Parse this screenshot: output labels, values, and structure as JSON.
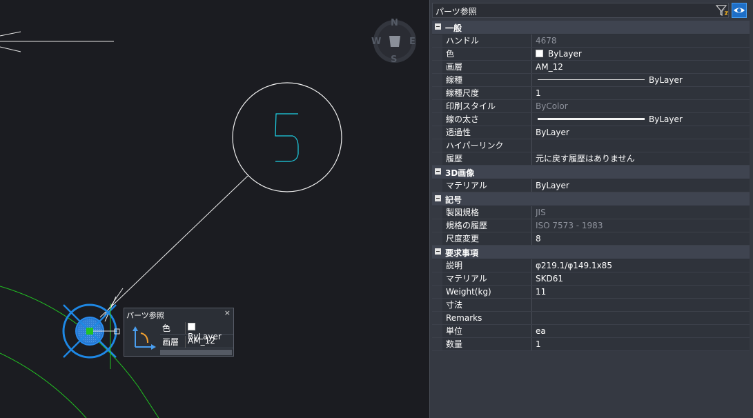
{
  "canvas": {
    "balloon_number": "5",
    "compass": {
      "n": "N",
      "s": "S",
      "e": "E",
      "w": "W"
    }
  },
  "panel": {
    "selector_value": "パーツ参照",
    "categories": [
      {
        "name": "一般",
        "rows": [
          {
            "label": "ハンドル",
            "value": "4678",
            "dim": true
          },
          {
            "label": "色",
            "value": "ByLayer",
            "swatch": true
          },
          {
            "label": "画層",
            "value": "AM_12"
          },
          {
            "label": "線種",
            "value": "ByLayer",
            "line": "thin"
          },
          {
            "label": "線種尺度",
            "value": "1"
          },
          {
            "label": "印刷スタイル",
            "value": "ByColor",
            "dim": true
          },
          {
            "label": "線の太さ",
            "value": "ByLayer",
            "line": "thick"
          },
          {
            "label": "透過性",
            "value": "ByLayer"
          },
          {
            "label": "ハイパーリンク",
            "value": ""
          },
          {
            "label": "履歴",
            "value": "元に戻す履歴はありません"
          }
        ]
      },
      {
        "name": "3D画像",
        "rows": [
          {
            "label": "マテリアル",
            "value": "ByLayer"
          }
        ]
      },
      {
        "name": "記号",
        "rows": [
          {
            "label": "製図規格",
            "value": "JIS",
            "dim": true
          },
          {
            "label": "規格の履歴",
            "value": "ISO 7573 - 1983",
            "dim": true
          },
          {
            "label": "尺度変更",
            "value": "8"
          }
        ]
      },
      {
        "name": "要求事項",
        "rows": [
          {
            "label": "説明",
            "value": "φ219.1/φ149.1x85"
          },
          {
            "label": "マテリアル",
            "value": "SKD61"
          },
          {
            "label": "Weight(kg)",
            "value": "11"
          },
          {
            "label": "寸法",
            "value": ""
          },
          {
            "label": "Remarks",
            "value": ""
          },
          {
            "label": "単位",
            "value": "ea"
          },
          {
            "label": "数量",
            "value": "1"
          }
        ]
      }
    ]
  },
  "popup": {
    "title": "パーツ参照",
    "close": "×",
    "rows": [
      {
        "label": "色",
        "value": "ByLayer",
        "swatch": true
      },
      {
        "label": "画層",
        "value": "AM_12"
      }
    ]
  },
  "colors": {
    "panel_bg": "#353942",
    "canvas_bg": "#1b1c21",
    "accent_blue": "#1e88e5",
    "green_arc": "#22c322",
    "cyan_text": "#1ed2e6"
  },
  "icons": [
    "filter-icon",
    "eye-icon",
    "chevron-down-icon",
    "ucs-icon",
    "close-icon",
    "collapse-icon"
  ]
}
